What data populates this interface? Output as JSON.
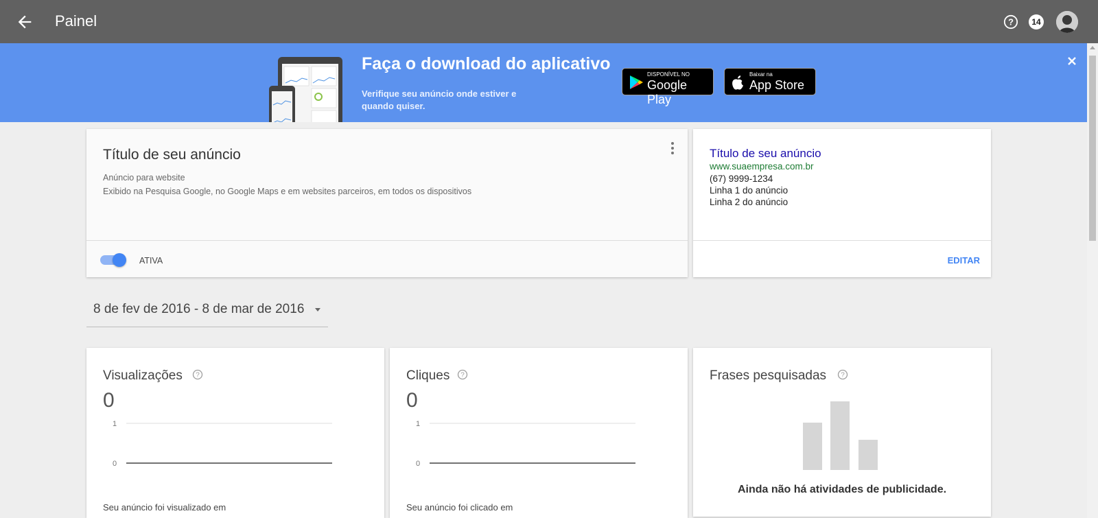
{
  "topbar": {
    "title": "Painel",
    "notification_count": "14"
  },
  "banner": {
    "title": "Faça o download do aplicativo",
    "subtitle": "Verifique seu anúncio onde estiver e quando quiser.",
    "google_play_small": "DISPONÍVEL NO",
    "google_play_big": "Google Play",
    "app_store_small": "Baixar na",
    "app_store_big": "App Store",
    "background_color": "#5c92ee"
  },
  "ad_card": {
    "title": "Título de seu anúncio",
    "type": "Anúncio para website",
    "description": "Exibido na Pesquisa Google, no Google Maps e em websites parceiros, em todos os dispositivos",
    "status_label": "ATIVA",
    "active": true
  },
  "preview": {
    "title": "Título de seu anúncio",
    "url": "www.suaempresa.com.br",
    "phone": "(67) 9999-1234",
    "line1": "Linha 1 do anúncio",
    "line2": "Linha 2 do anúncio",
    "edit_label": "EDITAR"
  },
  "date_range": {
    "label": "8 de fev de 2016 - 8 de mar de 2016"
  },
  "metrics": {
    "views": {
      "title": "Visualizações",
      "value": "0",
      "footer": "Seu anúncio foi visualizado em"
    },
    "clicks": {
      "title": "Cliques",
      "value": "0",
      "footer": "Seu anúncio foi clicado em"
    },
    "phrases": {
      "title": "Frases pesquisadas",
      "empty_message": "Ainda não há atividades de publicidade."
    }
  },
  "chart_data": [
    {
      "type": "line",
      "series": [],
      "ylim": [
        0,
        1
      ],
      "yticks": [
        "1",
        "0"
      ]
    },
    {
      "type": "line",
      "series": [],
      "ylim": [
        0,
        1
      ],
      "yticks": [
        "1",
        "0"
      ]
    }
  ],
  "colors": {
    "accent": "#4285f4",
    "topbar": "#616161",
    "link_title": "#1a0dab",
    "link_url": "#1e7c34"
  }
}
